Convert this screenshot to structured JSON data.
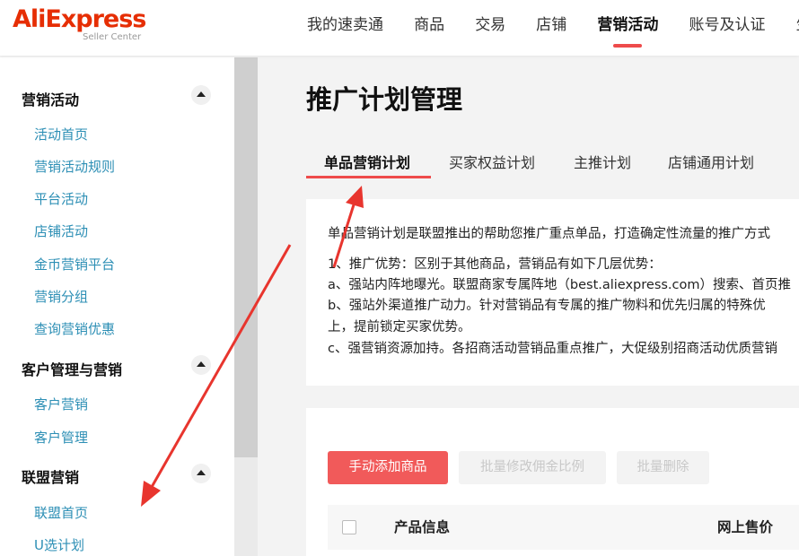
{
  "logo": {
    "name": "AliExpress",
    "sub": "Seller Center"
  },
  "top_nav": [
    "我的速卖通",
    "商品",
    "交易",
    "店铺",
    "营销活动",
    "账号及认证",
    "生意"
  ],
  "top_nav_active": "营销活动",
  "sidebar": {
    "sections": [
      {
        "title": "营销活动",
        "items": [
          "活动首页",
          "营销活动规则",
          "平台活动",
          "店铺活动",
          "金币营销平台",
          "营销分组",
          "查询营销优惠"
        ]
      },
      {
        "title": "客户管理与营销",
        "items": [
          "客户营销",
          "客户管理"
        ]
      },
      {
        "title": "联盟营销",
        "items": [
          "联盟首页",
          "U选计划"
        ]
      }
    ]
  },
  "main": {
    "title": "推广计划管理",
    "tabs": [
      "单品营销计划",
      "买家权益计划",
      "主推计划",
      "店铺通用计划"
    ],
    "active_tab": "单品营销计划",
    "description": [
      "单品营销计划是联盟推出的帮助您推广重点单品，打造确定性流量的推广方式",
      "1、推广优势：区别于其他商品，营销品有如下几层优势：",
      "a、强站内阵地曝光。联盟商家专属阵地（best.aliexpress.com）搜索、首页推",
      "b、强站外渠道推广动力。针对营销品有专属的推广物料和优先归属的特殊优",
      "上，提前锁定买家优势。",
      "c、强营销资源加持。各招商活动营销品重点推广，大促级别招商活动优质营销"
    ],
    "buttons": {
      "add": "手动添加商品",
      "batch_edit": "批量修改佣金比例",
      "batch_delete": "批量删除"
    },
    "table_headers": [
      "产品信息",
      "网上售价"
    ]
  },
  "colors": {
    "brand": "#e62e04",
    "accent": "#ee4b4b",
    "link": "#2d8fb5",
    "annotation": "#e8352e"
  }
}
